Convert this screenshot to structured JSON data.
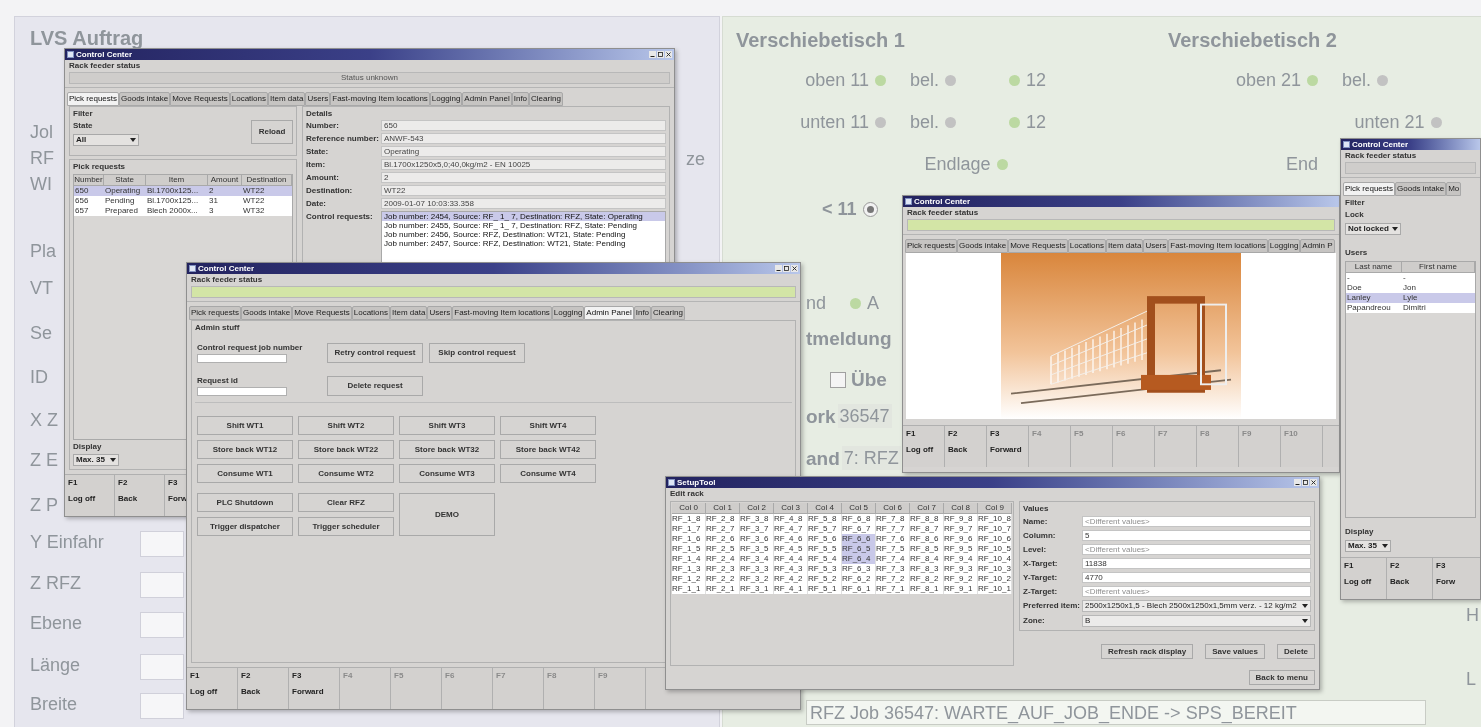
{
  "background": {
    "left_title": "LVS Auftrag",
    "left_labels": [
      "Jol",
      "RF",
      "WI",
      "Pla",
      "VT",
      "Se",
      "ID",
      "X Z",
      "Z E",
      "Z P",
      "Y Einfahr",
      "Z RFZ",
      "Ebene",
      "Länge",
      "Breite"
    ],
    "left_fragment": "ze",
    "tables": [
      {
        "title": "Verschiebetisch 1",
        "rows": [
          [
            {
              "label": "oben 11",
              "color": "#bcd9a2",
              "kind": "dot_after"
            },
            {
              "label": "bel.",
              "color": "#c2c2c2",
              "kind": "dot_after"
            },
            {
              "label": "12",
              "color": "#bcd9a2",
              "kind": "dot_before"
            }
          ],
          [
            {
              "label": "unten 11",
              "color": "#c2c2c2",
              "kind": "dot_after"
            },
            {
              "label": "bel.",
              "color": "#c2c2c2",
              "kind": "dot_after"
            },
            {
              "label": "12",
              "color": "#bcd9a2",
              "kind": "dot_before"
            }
          ],
          [
            {
              "label": "Endlage",
              "color": "#bcd9a2",
              "kind": "dot_after"
            }
          ]
        ]
      },
      {
        "title": "Verschiebetisch 2",
        "rows": [
          [
            {
              "label": "oben 21",
              "color": "#bcd9a2",
              "kind": "dot_after"
            },
            {
              "label": "bel.",
              "color": "#c2c2c2",
              "kind": "dot_after"
            }
          ],
          [
            {
              "label": "unten 21",
              "color": "#c2c2c2",
              "kind": "dot_after"
            }
          ],
          [
            {
              "label": "End",
              "kind": "text"
            }
          ]
        ]
      }
    ],
    "shift_selector": {
      "label": "< 11",
      "selected": true
    },
    "status_area": {
      "fragment": "nd",
      "indicator": {
        "label": "A",
        "color": "#bcd9a2"
      },
      "heading": "tmeldung",
      "checkbox": {
        "label": "Übe",
        "checked": false
      },
      "rows": [
        {
          "label": "ork",
          "value": "36547"
        },
        {
          "label": "and",
          "value": "7: RFZ"
        }
      ],
      "message": "RFZ Job 36547: WARTE_AUF_JOB_ENDE -> SPS_BEREIT"
    },
    "right_fragments": [
      "H",
      "L"
    ]
  },
  "pick_window": {
    "title": "Control Center",
    "status_label": "Rack feeder status",
    "status_ok": false,
    "status": "Status unknown",
    "tabs": [
      {
        "label": "Pick requests",
        "selected": true
      },
      {
        "label": "Goods intake",
        "selected": false
      },
      {
        "label": "Move Requests",
        "selected": false
      },
      {
        "label": "Locations",
        "selected": false
      },
      {
        "label": "Item data",
        "selected": false
      },
      {
        "label": "Users",
        "selected": false
      },
      {
        "label": "Fast-moving Item locations",
        "selected": false
      },
      {
        "label": "Logging",
        "selected": false
      },
      {
        "label": "Admin Panel",
        "selected": false
      },
      {
        "label": "Info",
        "selected": false
      },
      {
        "label": "Clearing",
        "selected": false
      }
    ],
    "filter": {
      "title": "Filter",
      "label": "State",
      "value": "All",
      "button": "Reload"
    },
    "table": {
      "title": "Pick requests",
      "columns": [
        "Number",
        "State",
        "Item",
        "Amount",
        "Destination"
      ],
      "rows": [
        {
          "cells": [
            "650",
            "Operating",
            "Bl.1700x125...",
            "2",
            "WT22"
          ],
          "selected": true
        },
        {
          "cells": [
            "656",
            "Pending",
            "Bl.1700x125...",
            "31",
            "WT22"
          ],
          "selected": false
        },
        {
          "cells": [
            "657",
            "Prepared",
            "Blech 2000x...",
            "3",
            "WT32"
          ],
          "selected": false
        }
      ]
    },
    "display": {
      "label": "Display",
      "value": "Max. 35"
    },
    "details": {
      "title": "Details",
      "fields": [
        {
          "label": "Number:",
          "value": "650"
        },
        {
          "label": "Reference number:",
          "value": "ANWF-543"
        },
        {
          "label": "State:",
          "value": "Operating"
        },
        {
          "label": "Item:",
          "value": "Bl.1700x1250x5,0;40,0kg/m2 - EN 10025"
        },
        {
          "label": "Amount:",
          "value": "2"
        },
        {
          "label": "Destination:",
          "value": "WT22"
        },
        {
          "label": "Date:",
          "value": "2009-01-07 10:03:33.358"
        }
      ],
      "requests_label": "Control requests:",
      "requests": [
        {
          "text": "Job number: 2454, Source: RF_ 1_ 7, Destination: RFZ, State: Operating",
          "selected": true
        },
        {
          "text": "Job number: 2455, Source: RF_ 1_ 7, Destination: RFZ, State: Pending",
          "selected": false
        },
        {
          "text": "Job number: 2456, Source: RFZ, Destination: WT21, State: Pending",
          "selected": false
        },
        {
          "text": "Job number: 2457, Source: RFZ, Destination: WT21, State: Pending",
          "selected": false
        }
      ]
    },
    "fkeys": [
      {
        "key": "F1",
        "label": "Log off",
        "disabled": false
      },
      {
        "key": "F2",
        "label": "Back",
        "disabled": false
      },
      {
        "key": "F3",
        "label": "Forw",
        "disabled": false
      }
    ]
  },
  "admin_window": {
    "title": "Control Center",
    "status_label": "Rack feeder status",
    "status_ok": true,
    "tabs": [
      {
        "label": "Pick requests",
        "selected": false
      },
      {
        "label": "Goods intake",
        "selected": false
      },
      {
        "label": "Move Requests",
        "selected": false
      },
      {
        "label": "Locations",
        "selected": false
      },
      {
        "label": "Item data",
        "selected": false
      },
      {
        "label": "Users",
        "selected": false
      },
      {
        "label": "Fast-moving Item locations",
        "selected": false
      },
      {
        "label": "Logging",
        "selected": false
      },
      {
        "label": "Admin Panel",
        "selected": true
      },
      {
        "label": "Info",
        "selected": false
      },
      {
        "label": "Clearing",
        "selected": false
      }
    ],
    "group_title": "Admin stuff",
    "job_field": {
      "label": "Control request job number"
    },
    "retry_button": "Retry control request",
    "skip_button": "Skip control request",
    "request_field": {
      "label": "Request id"
    },
    "delete_button": "Delete request",
    "grid_buttons": [
      [
        "Shift WT1",
        "Shift WT2",
        "Shift WT3",
        "Shift WT4"
      ],
      [
        "Store back WT12",
        "Store back WT22",
        "Store back WT32",
        "Store back WT42"
      ],
      [
        "Consume WT1",
        "Consume WT2",
        "Consume WT3",
        "Consume WT4"
      ]
    ],
    "bottom_buttons": [
      [
        "PLC Shutdown",
        "Clear RFZ"
      ],
      [
        "Trigger dispatcher",
        "Trigger scheduler"
      ]
    ],
    "demo_button": "DEMO",
    "fkeys": [
      {
        "key": "F1",
        "label": "Log off",
        "disabled": false
      },
      {
        "key": "F2",
        "label": "Back",
        "disabled": false
      },
      {
        "key": "F3",
        "label": "Forward",
        "disabled": false
      },
      {
        "key": "F4",
        "disabled": true
      },
      {
        "key": "F5",
        "disabled": true
      },
      {
        "key": "F6",
        "disabled": true
      },
      {
        "key": "F7",
        "disabled": true
      },
      {
        "key": "F8",
        "disabled": true
      },
      {
        "key": "F9",
        "disabled": true
      }
    ]
  },
  "image_window": {
    "title": "Control Center",
    "status_label": "Rack feeder status",
    "status_ok": true,
    "tabs": [
      {
        "label": "Pick requests",
        "selected": false
      },
      {
        "label": "Goods intake",
        "selected": false
      },
      {
        "label": "Move Requests",
        "selected": false
      },
      {
        "label": "Locations",
        "selected": false
      },
      {
        "label": "Item data",
        "selected": false
      },
      {
        "label": "Users",
        "selected": false
      },
      {
        "label": "Fast-moving Item locations",
        "selected": false
      },
      {
        "label": "Logging",
        "selected": false
      },
      {
        "label": "Admin P",
        "selected": false
      }
    ],
    "fkeys": [
      {
        "key": "F1",
        "label": "Log off",
        "disabled": false
      },
      {
        "key": "F2",
        "label": "Back",
        "disabled": false
      },
      {
        "key": "F3",
        "label": "Forward",
        "disabled": false
      },
      {
        "key": "F4",
        "disabled": true
      },
      {
        "key": "F5",
        "disabled": true
      },
      {
        "key": "F6",
        "disabled": true
      },
      {
        "key": "F7",
        "disabled": true
      },
      {
        "key": "F8",
        "disabled": true
      },
      {
        "key": "F9",
        "disabled": true
      },
      {
        "key": "F10",
        "disabled": true
      }
    ]
  },
  "users_window": {
    "title": "Control Center",
    "status_label": "Rack feeder status",
    "status_ok": false,
    "tabs": [
      {
        "label": "Pick requests",
        "selected": true
      },
      {
        "label": "Goods intake",
        "selected": false
      },
      {
        "label": "Mo",
        "selected": false
      }
    ],
    "filter": {
      "title": "Filter",
      "label": "Lock",
      "value": "Not locked"
    },
    "users": {
      "title": "Users",
      "columns": [
        "Last name",
        "First name"
      ],
      "rows": [
        {
          "cells": [
            "-",
            "-"
          ],
          "selected": false
        },
        {
          "cells": [
            "Doe",
            "Jon"
          ],
          "selected": false
        },
        {
          "cells": [
            "Lanley",
            "Lyle"
          ],
          "selected": true
        },
        {
          "cells": [
            "Papandreou",
            "Dimitri"
          ],
          "selected": false
        }
      ]
    },
    "display": {
      "label": "Display",
      "value": "Max. 35"
    },
    "fkeys": [
      {
        "key": "F1",
        "label": "Log off",
        "disabled": false
      },
      {
        "key": "F2",
        "label": "Back",
        "disabled": false
      },
      {
        "key": "F3",
        "label": "Forw",
        "disabled": false
      }
    ]
  },
  "setup_window": {
    "title": "SetupTool",
    "panel_title": "Edit rack",
    "columns": [
      "Col 0",
      "Col 1",
      "Col 2",
      "Col 3",
      "Col 4",
      "Col 5",
      "Col 6",
      "Col 7",
      "Col 8",
      "Col 9"
    ],
    "rows": [
      [
        {
          "text": "RF_1_8",
          "selected": false
        },
        {
          "text": "RF_2_8",
          "selected": false
        },
        {
          "text": "RF_3_8",
          "selected": false
        },
        {
          "text": "RF_4_8",
          "selected": false
        },
        {
          "text": "RF_5_8",
          "selected": false
        },
        {
          "text": "RF_6_8",
          "selected": false
        },
        {
          "text": "RF_7_8",
          "selected": false
        },
        {
          "text": "RF_8_8",
          "selected": false
        },
        {
          "text": "RF_9_8",
          "selected": false
        },
        {
          "text": "RF_10_8",
          "selected": false
        }
      ],
      [
        {
          "text": "RF_1_7",
          "selected": false
        },
        {
          "text": "RF_2_7",
          "selected": false
        },
        {
          "text": "RF_3_7",
          "selected": false
        },
        {
          "text": "RF_4_7",
          "selected": false
        },
        {
          "text": "RF_5_7",
          "selected": false
        },
        {
          "text": "RF_6_7",
          "selected": false
        },
        {
          "text": "RF_7_7",
          "selected": false
        },
        {
          "text": "RF_8_7",
          "selected": false
        },
        {
          "text": "RF_9_7",
          "selected": false
        },
        {
          "text": "RF_10_7",
          "selected": false
        }
      ],
      [
        {
          "text": "RF_1_6",
          "selected": false
        },
        {
          "text": "RF_2_6",
          "selected": false
        },
        {
          "text": "RF_3_6",
          "selected": false
        },
        {
          "text": "RF_4_6",
          "selected": false
        },
        {
          "text": "RF_5_6",
          "selected": false
        },
        {
          "text": "RF_6_6",
          "selected": true
        },
        {
          "text": "RF_7_6",
          "selected": false
        },
        {
          "text": "RF_8_6",
          "selected": false
        },
        {
          "text": "RF_9_6",
          "selected": false
        },
        {
          "text": "RF_10_6",
          "selected": false
        }
      ],
      [
        {
          "text": "RF_1_5",
          "selected": false
        },
        {
          "text": "RF_2_5",
          "selected": false
        },
        {
          "text": "RF_3_5",
          "selected": false
        },
        {
          "text": "RF_4_5",
          "selected": false
        },
        {
          "text": "RF_5_5",
          "selected": false
        },
        {
          "text": "RF_6_5",
          "selected": true
        },
        {
          "text": "RF_7_5",
          "selected": false
        },
        {
          "text": "RF_8_5",
          "selected": false
        },
        {
          "text": "RF_9_5",
          "selected": false
        },
        {
          "text": "RF_10_5",
          "selected": false
        }
      ],
      [
        {
          "text": "RF_1_4",
          "selected": false
        },
        {
          "text": "RF_2_4",
          "selected": false
        },
        {
          "text": "RF_3_4",
          "selected": false
        },
        {
          "text": "RF_4_4",
          "selected": false
        },
        {
          "text": "RF_5_4",
          "selected": false
        },
        {
          "text": "RF_6_4",
          "selected": true
        },
        {
          "text": "RF_7_4",
          "selected": false
        },
        {
          "text": "RF_8_4",
          "selected": false
        },
        {
          "text": "RF_9_4",
          "selected": false
        },
        {
          "text": "RF_10_4",
          "selected": false
        }
      ],
      [
        {
          "text": "RF_1_3",
          "selected": false
        },
        {
          "text": "RF_2_3",
          "selected": false
        },
        {
          "text": "RF_3_3",
          "selected": false
        },
        {
          "text": "RF_4_3",
          "selected": false
        },
        {
          "text": "RF_5_3",
          "selected": false
        },
        {
          "text": "RF_6_3",
          "selected": false
        },
        {
          "text": "RF_7_3",
          "selected": false
        },
        {
          "text": "RF_8_3",
          "selected": false
        },
        {
          "text": "RF_9_3",
          "selected": false
        },
        {
          "text": "RF_10_3",
          "selected": false
        }
      ],
      [
        {
          "text": "RF_1_2",
          "selected": false
        },
        {
          "text": "RF_2_2",
          "selected": false
        },
        {
          "text": "RF_3_2",
          "selected": false
        },
        {
          "text": "RF_4_2",
          "selected": false
        },
        {
          "text": "RF_5_2",
          "selected": false
        },
        {
          "text": "RF_6_2",
          "selected": false
        },
        {
          "text": "RF_7_2",
          "selected": false
        },
        {
          "text": "RF_8_2",
          "selected": false
        },
        {
          "text": "RF_9_2",
          "selected": false
        },
        {
          "text": "RF_10_2",
          "selected": false
        }
      ],
      [
        {
          "text": "RF_1_1",
          "selected": false
        },
        {
          "text": "RF_2_1",
          "selected": false
        },
        {
          "text": "RF_3_1",
          "selected": false
        },
        {
          "text": "RF_4_1",
          "selected": false
        },
        {
          "text": "RF_5_1",
          "selected": false
        },
        {
          "text": "RF_6_1",
          "selected": false
        },
        {
          "text": "RF_7_1",
          "selected": false
        },
        {
          "text": "RF_8_1",
          "selected": false
        },
        {
          "text": "RF_9_1",
          "selected": false
        },
        {
          "text": "RF_10_1",
          "selected": false
        }
      ]
    ],
    "values": {
      "title": "Values",
      "fields": [
        {
          "label": "Name:",
          "placeholder": "<Different values>",
          "kind": "text"
        },
        {
          "label": "Column:",
          "value": "5",
          "kind": "text"
        },
        {
          "label": "Level:",
          "placeholder": "<Different values>",
          "kind": "text"
        },
        {
          "label": "X-Target:",
          "value": "11838",
          "kind": "text"
        },
        {
          "label": "Y-Target:",
          "value": "4770",
          "kind": "text"
        },
        {
          "label": "Z-Target:",
          "placeholder": "<Different values>",
          "kind": "text"
        },
        {
          "label": "Preferred item:",
          "value": "2500x1250x1,5 - Blech 2500x1250x1,5mm verz. - 12 kg/m2",
          "kind": "select"
        },
        {
          "label": "Zone:",
          "value": "B",
          "kind": "select"
        }
      ]
    },
    "buttons": [
      "Refresh rack display",
      "Save values",
      "Delete"
    ],
    "back_button": "Back to menu"
  }
}
